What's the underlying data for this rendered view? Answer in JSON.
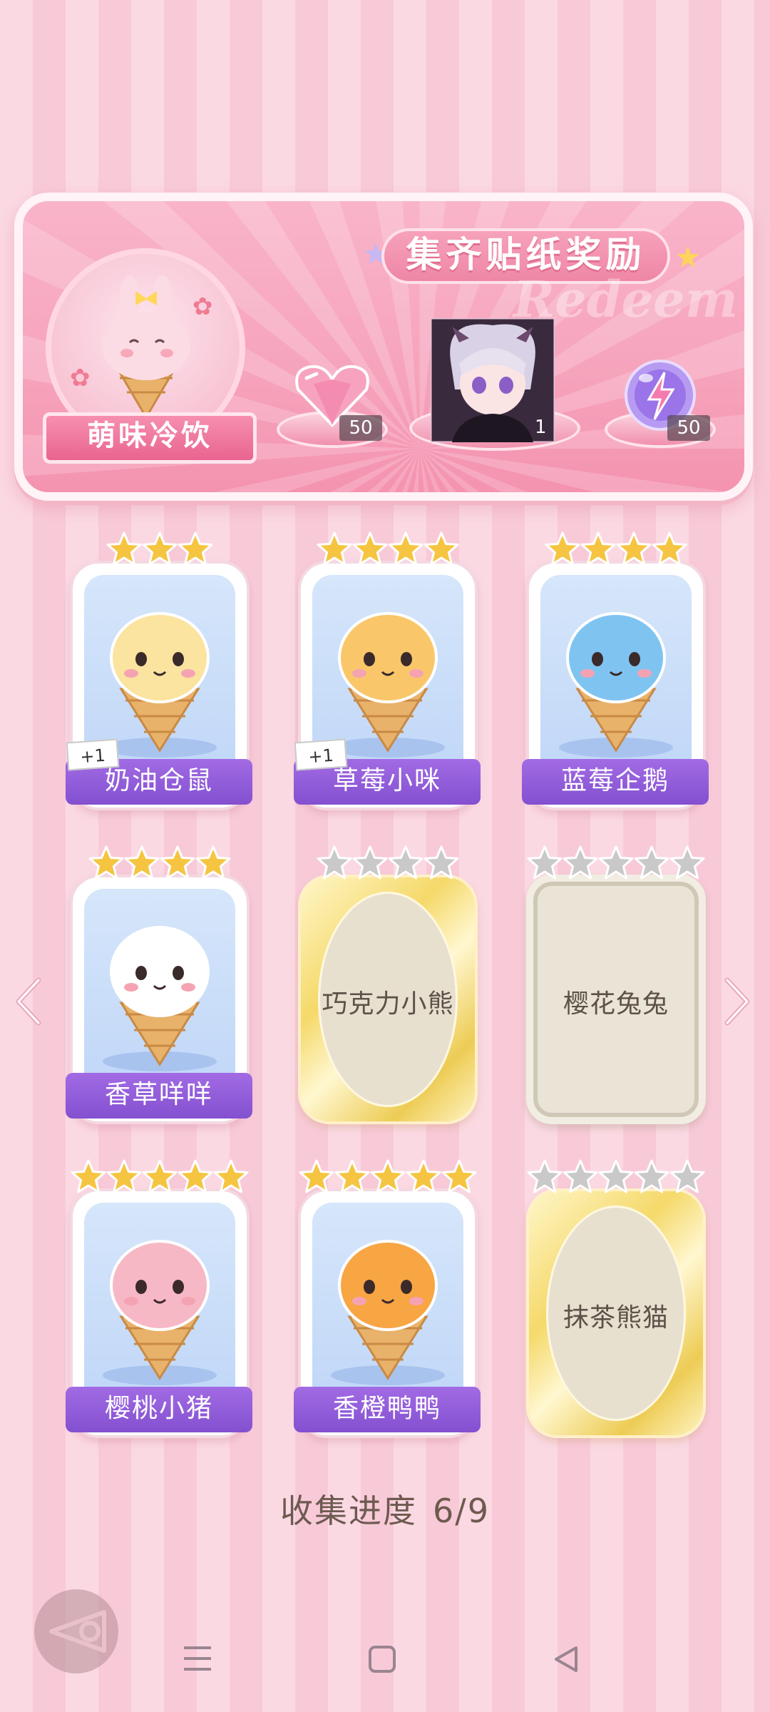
{
  "reward_banner": {
    "title": "集齐贴纸奖励",
    "watermark": "Redeem",
    "series_name": "萌味冷饮",
    "rewards": [
      {
        "icon": "pink-heart-gem-icon",
        "count": "50"
      },
      {
        "icon": "character-portrait",
        "count": "1"
      },
      {
        "icon": "purple-energy-orb-icon",
        "count": "50"
      }
    ]
  },
  "stickers": [
    {
      "name": "奶油仓鼠",
      "stars": 3,
      "collected": true,
      "extra": "+1",
      "color": "#fbe3a0"
    },
    {
      "name": "草莓小咪",
      "stars": 4,
      "collected": true,
      "extra": "+1",
      "color": "#f9c76a"
    },
    {
      "name": "蓝莓企鹅",
      "stars": 4,
      "collected": true,
      "extra": "",
      "color": "#7fc4f1"
    },
    {
      "name": "香草咩咩",
      "stars": 4,
      "collected": true,
      "extra": "",
      "color": "#ffffff"
    },
    {
      "name": "巧克力小熊",
      "stars": 4,
      "collected": false,
      "extra": "",
      "color": ""
    },
    {
      "name": "樱花兔兔",
      "stars": 5,
      "collected": false,
      "extra": "",
      "color": ""
    },
    {
      "name": "樱桃小猪",
      "stars": 5,
      "collected": true,
      "extra": "",
      "color": "#f7b8c6"
    },
    {
      "name": "香橙鸭鸭",
      "stars": 5,
      "collected": true,
      "extra": "",
      "color": "#f8a544"
    },
    {
      "name": "抹茶熊猫",
      "stars": 5,
      "collected": false,
      "extra": "",
      "color": ""
    }
  ],
  "progress": {
    "label": "收集进度",
    "value": "6/9"
  },
  "colors": {
    "accent_purple": "#8f5bd8",
    "accent_pink": "#f493b0",
    "star_gold": "#f5c542",
    "star_gray": "#c9c9c9"
  }
}
